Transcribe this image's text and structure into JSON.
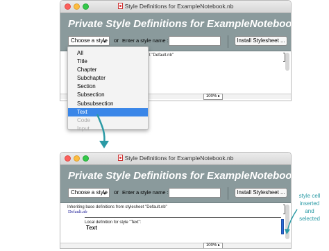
{
  "top_window": {
    "title": "Style Definitions for ExampleNotebook.nb",
    "banner": "Private Style Definitions for  ExampleNotebook.nb",
    "choose_style": "Choose a style",
    "or_label": "or",
    "enter_label": "Enter a style name :",
    "install_button": "Install Stylesheet ...",
    "inherit_fragment": "t \"Default.nb\"",
    "zoom": "100%"
  },
  "menu": {
    "items": [
      "All",
      "Title",
      "Chapter",
      "Subchapter",
      "Section",
      "Subsection",
      "Subsubsection",
      "Text",
      "Code",
      "Input"
    ],
    "selected": "Text",
    "dimmed": [
      "Code",
      "Input"
    ]
  },
  "bottom_window": {
    "title": "Style Definitions for ExampleNotebook.nb",
    "banner": "Private Style Definitions for  ExampleNotebook.nb",
    "choose_style": "Choose a style",
    "or_label": "or",
    "enter_label": "Enter a style name :",
    "install_button": "Install Stylesheet ...",
    "inherit_text": "Inheriting base definitions from stylesheet \"Default.nb\"",
    "default_nb": "Default.nb",
    "local_text": "Local definition for style \"Text\":",
    "style_text": "Text",
    "zoom": "100%"
  },
  "annotation": {
    "text": "style cell inserted and selected"
  },
  "colors": {
    "banner": "#8a9a9c",
    "menu_selection": "#3a86e8",
    "annotation": "#2a9aa5",
    "cell_bracket_selected": "#2b6bd9"
  }
}
